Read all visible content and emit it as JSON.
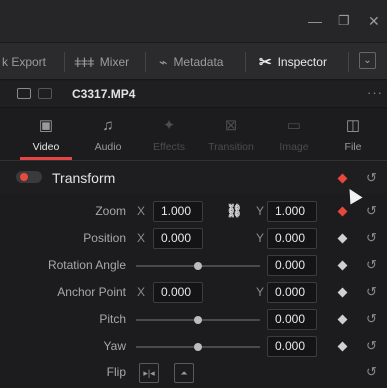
{
  "window": {
    "minimize_glyph": "—",
    "restore_glyph": "❐",
    "close_glyph": "✕"
  },
  "toolbar": {
    "render_label": "k Export",
    "mixer_label": "Mixer",
    "metadata_label": "Metadata",
    "inspector_label": "Inspector",
    "expand_glyph": "⌄"
  },
  "clip": {
    "name": "C3317.MP4",
    "more": "···"
  },
  "tabs": [
    {
      "label": "Video",
      "icon": "film-icon",
      "glyph": "▣",
      "state": "active"
    },
    {
      "label": "Audio",
      "icon": "music-note-icon",
      "glyph": "♫",
      "state": "enabled"
    },
    {
      "label": "Effects",
      "icon": "effects-icon",
      "glyph": "✦",
      "state": "disabled"
    },
    {
      "label": "Transition",
      "icon": "transition-icon",
      "glyph": "⊠",
      "state": "disabled"
    },
    {
      "label": "Image",
      "icon": "image-icon",
      "glyph": "▭",
      "state": "disabled"
    },
    {
      "label": "File",
      "icon": "file-icon",
      "glyph": "◫",
      "state": "enabled"
    }
  ],
  "section": {
    "title": "Transform",
    "enabled": true,
    "keyframe_color": "#e8473a",
    "reset_glyph": "↺"
  },
  "params": {
    "zoom": {
      "label": "Zoom",
      "x_axis": "X",
      "x": "1.000",
      "y_axis": "Y",
      "y": "1.000",
      "linked": true,
      "link_glyph": "🔗",
      "keyframe_active": true
    },
    "position": {
      "label": "Position",
      "x_axis": "X",
      "x": "0.000",
      "y_axis": "Y",
      "y": "0.000"
    },
    "rotation": {
      "label": "Rotation Angle",
      "value": "0.000",
      "slider_level": 0.5
    },
    "anchor": {
      "label": "Anchor Point",
      "x_axis": "X",
      "x": "0.000",
      "y_axis": "Y",
      "y": "0.000"
    },
    "pitch": {
      "label": "Pitch",
      "value": "0.000",
      "slider_level": 0.5
    },
    "yaw": {
      "label": "Yaw",
      "value": "0.000",
      "slider_level": 0.5
    },
    "flip": {
      "label": "Flip",
      "h_glyph": "▸|◂",
      "v_glyph": "⏶"
    }
  },
  "colors": {
    "accent_red": "#e64545",
    "keyframe_inactive": "#d0d0d0"
  }
}
